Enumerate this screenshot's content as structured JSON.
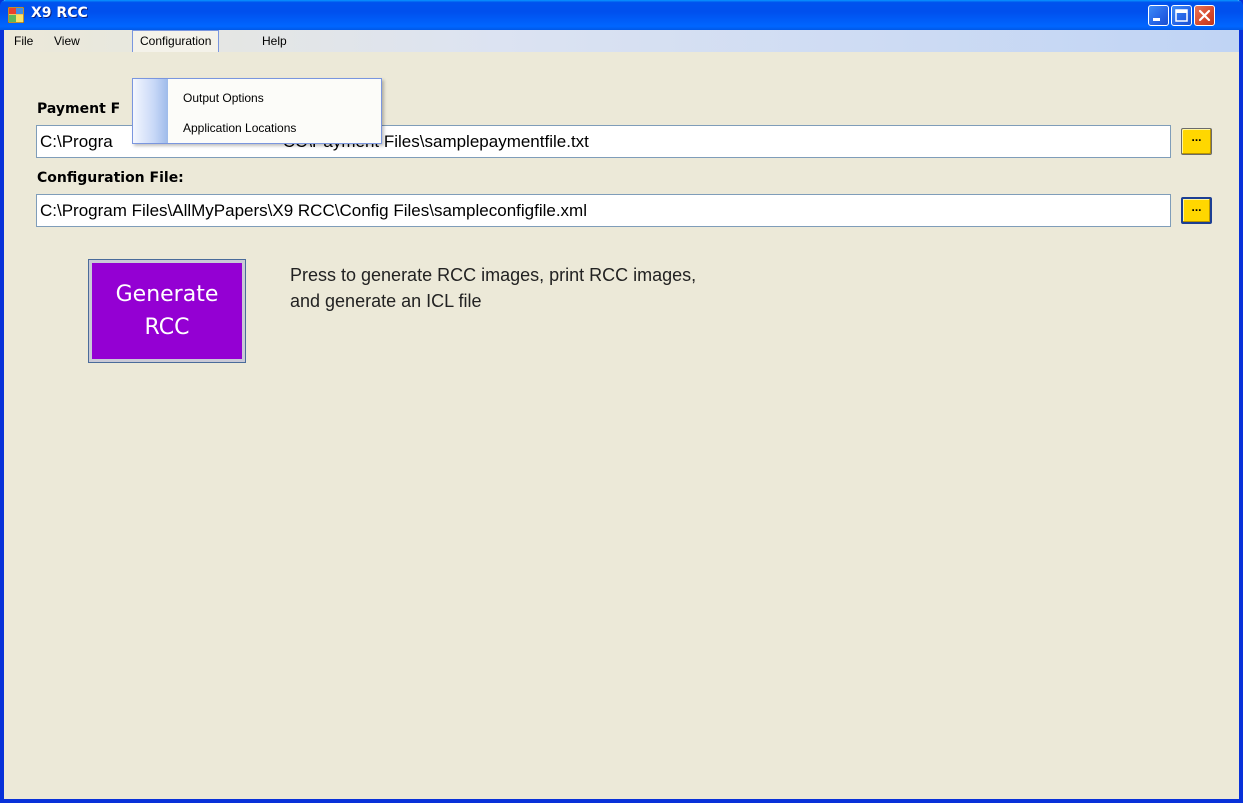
{
  "window": {
    "title": "X9 RCC"
  },
  "menu": {
    "items": [
      "File",
      "View",
      "Configuration",
      "Help"
    ],
    "open_menu": "Configuration",
    "configuration_items": [
      "Output Options",
      "Application Locations"
    ]
  },
  "payment_file": {
    "label": "Payment F",
    "value": "C:\\Progra                                    CC\\Payment Files\\samplepaymentfile.txt",
    "browse_label": "..."
  },
  "configuration_file": {
    "label": "Configuration File:",
    "value": "C:\\Program Files\\AllMyPapers\\X9 RCC\\Config Files\\sampleconfigfile.xml",
    "browse_label": "..."
  },
  "generate": {
    "line1": "Generate",
    "line2": "RCC",
    "hint_line1": "Press to generate RCC images, print RCC images,",
    "hint_line2": "and generate an ICL file"
  },
  "colors": {
    "titlebar": "#0058e6",
    "generate_button": "#9400d3",
    "browse_button": "#ffd700",
    "background": "#ece9d8"
  },
  "icons": {
    "app": "app-icon",
    "minimize": "minimize-icon",
    "maximize": "maximize-icon",
    "close": "close-icon"
  }
}
